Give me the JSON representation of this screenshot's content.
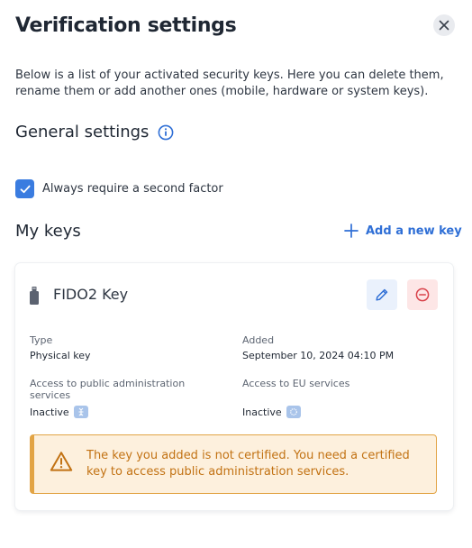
{
  "header": {
    "title": "Verification settings",
    "close_icon": "close-icon"
  },
  "description": "Below is a list of your activated security keys. Here you can delete them, rename them or add another ones (mobile, hardware or system keys).",
  "general": {
    "title": "General settings",
    "info_icon": "info-icon",
    "checkbox_label": "Always require a second factor",
    "checkbox_checked": true
  },
  "keys": {
    "title": "My keys",
    "add_label": "Add a new key",
    "items": [
      {
        "name": "FIDO2 Key",
        "type_label": "Type",
        "type_value": "Physical key",
        "added_label": "Added",
        "added_value": "September 10, 2024 04:10 PM",
        "public_admin_label": "Access to public administration services",
        "public_admin_value": "Inactive",
        "eu_label": "Access to EU services",
        "eu_value": "Inactive",
        "warning": "The key you added is not certified. You need a certified key to access public administration services."
      }
    ]
  },
  "colors": {
    "accent": "#3a7ce0",
    "link": "#2f6fd6",
    "danger": "#d9424a",
    "warning_border": "#e2a445",
    "warning_text": "#c27213",
    "warning_bg": "#fdf0dd"
  }
}
